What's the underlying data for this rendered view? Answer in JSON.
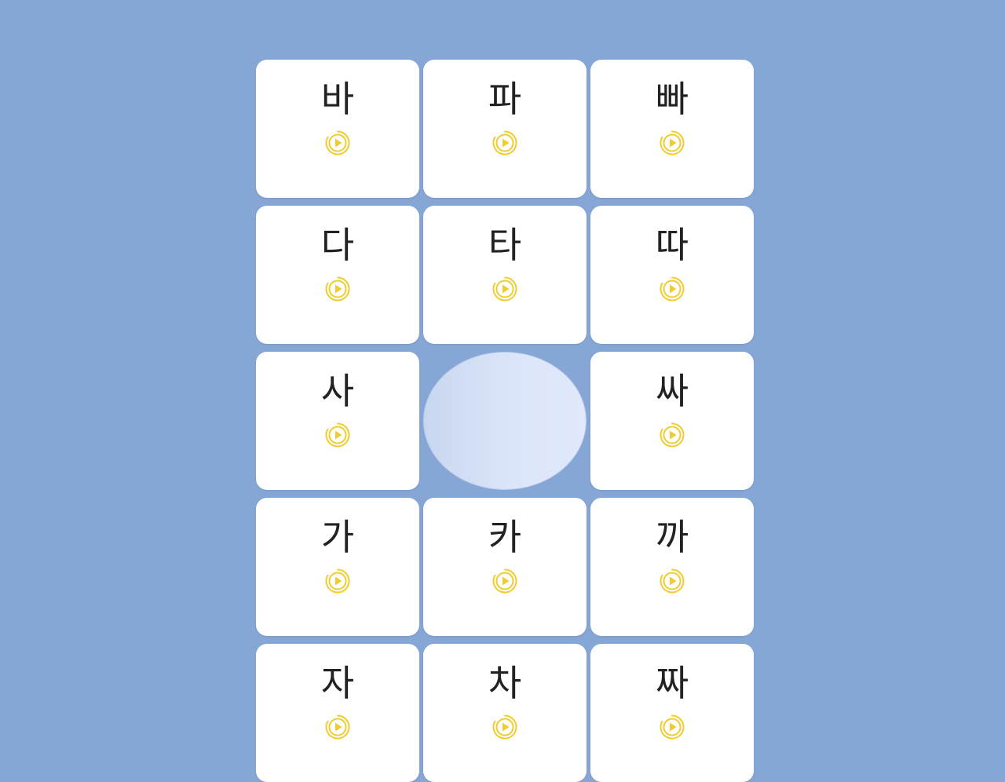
{
  "colors": {
    "background": "#86a6d6",
    "card": "#ffffff",
    "text": "#222222",
    "play_icon": "#f2cc2e"
  },
  "cards": [
    {
      "syllable": "바",
      "icon": "play-audio-icon"
    },
    {
      "syllable": "파",
      "icon": "play-audio-icon"
    },
    {
      "syllable": "빠",
      "icon": "play-audio-icon"
    },
    {
      "syllable": "다",
      "icon": "play-audio-icon"
    },
    {
      "syllable": "타",
      "icon": "play-audio-icon"
    },
    {
      "syllable": "따",
      "icon": "play-audio-icon"
    },
    {
      "syllable": "사",
      "icon": "play-audio-icon"
    },
    {
      "syllable": "",
      "icon": "",
      "empty": true
    },
    {
      "syllable": "싸",
      "icon": "play-audio-icon"
    },
    {
      "syllable": "가",
      "icon": "play-audio-icon"
    },
    {
      "syllable": "카",
      "icon": "play-audio-icon"
    },
    {
      "syllable": "까",
      "icon": "play-audio-icon"
    },
    {
      "syllable": "자",
      "icon": "play-audio-icon"
    },
    {
      "syllable": "차",
      "icon": "play-audio-icon"
    },
    {
      "syllable": "짜",
      "icon": "play-audio-icon"
    }
  ]
}
